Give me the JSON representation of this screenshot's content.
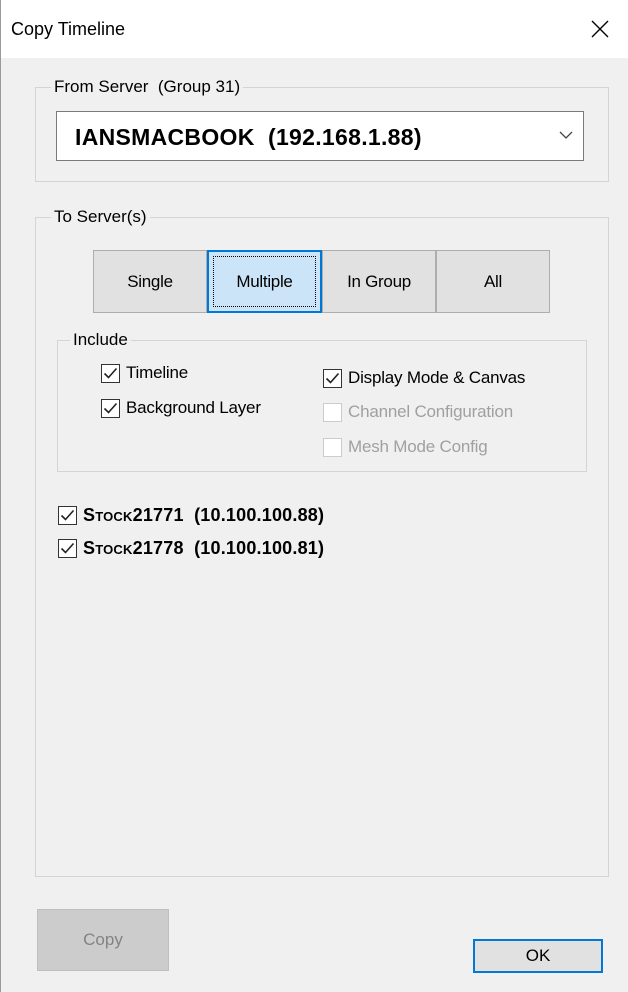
{
  "window": {
    "title": "Copy Timeline"
  },
  "from_server": {
    "legend": "From Server  (Group 31)",
    "selected": "IANSMACBOOK  (192.168.1.88)"
  },
  "to_servers": {
    "legend": "To Server(s)",
    "mode_buttons": [
      {
        "label": "Single",
        "active": false
      },
      {
        "label": "Multiple",
        "active": true
      },
      {
        "label": "In Group",
        "active": false
      },
      {
        "label": "All",
        "active": false
      }
    ],
    "include": {
      "legend": "Include",
      "options": [
        {
          "label": "Timeline",
          "checked": true,
          "enabled": true
        },
        {
          "label": "Background Layer",
          "checked": true,
          "enabled": true
        },
        {
          "label": "Display Mode & Canvas",
          "checked": true,
          "enabled": true
        },
        {
          "label": "Channel Configuration",
          "checked": false,
          "enabled": false
        },
        {
          "label": "Mesh Mode Config",
          "checked": false,
          "enabled": false
        }
      ]
    },
    "servers": [
      {
        "name_initial": "S",
        "name_caps": "tock",
        "name_digits": "21771",
        "ip": "  (10.100.100.88)",
        "checked": true
      },
      {
        "name_initial": "S",
        "name_caps": "tock",
        "name_digits": "21778",
        "ip": "  (10.100.100.81)",
        "checked": true
      }
    ]
  },
  "footer": {
    "copy_label": "Copy",
    "ok_label": "OK"
  },
  "colors": {
    "accent": "#0078d7",
    "active_fill": "#cce4f7",
    "window_bg": "#f0f0f0"
  }
}
